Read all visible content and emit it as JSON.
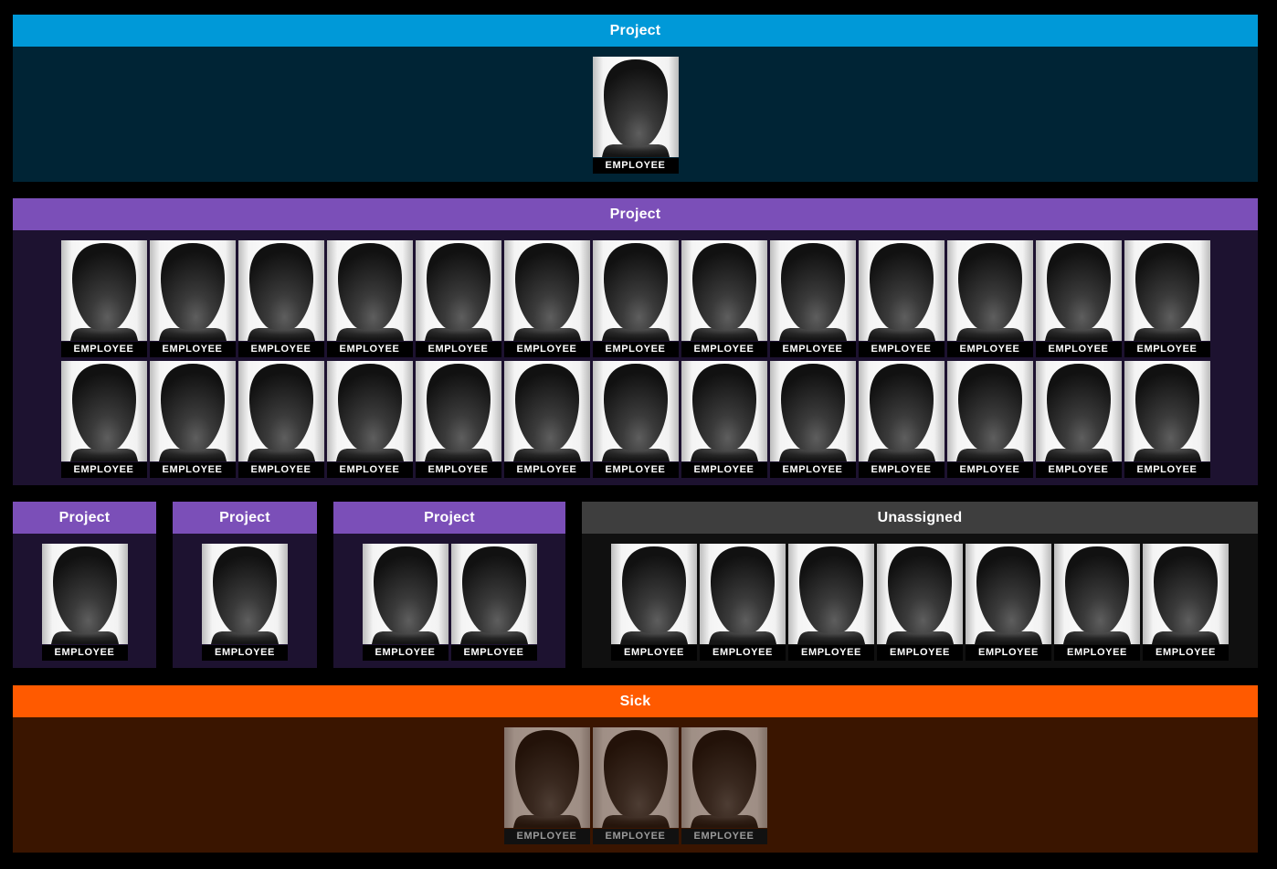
{
  "colors": {
    "page_bg": "#000000",
    "project_blue_header": "#0099D8",
    "project_blue_body": "#002435",
    "project_purple_header": "#7B4FB8",
    "project_purple_body": "#1D1230",
    "unassigned_header": "#3E3E3E",
    "unassigned_body": "#101010",
    "sick_header": "#FF5A00",
    "sick_body": "#3A1500"
  },
  "groups": [
    {
      "id": "g1",
      "title": "Project",
      "theme": "blue",
      "employees": [
        "EMPLOYEE"
      ]
    },
    {
      "id": "g2",
      "title": "Project",
      "theme": "purple",
      "employees": [
        "EMPLOYEE",
        "EMPLOYEE",
        "EMPLOYEE",
        "EMPLOYEE",
        "EMPLOYEE",
        "EMPLOYEE",
        "EMPLOYEE",
        "EMPLOYEE",
        "EMPLOYEE",
        "EMPLOYEE",
        "EMPLOYEE",
        "EMPLOYEE",
        "EMPLOYEE",
        "EMPLOYEE",
        "EMPLOYEE",
        "EMPLOYEE",
        "EMPLOYEE",
        "EMPLOYEE",
        "EMPLOYEE",
        "EMPLOYEE",
        "EMPLOYEE",
        "EMPLOYEE",
        "EMPLOYEE",
        "EMPLOYEE",
        "EMPLOYEE",
        "EMPLOYEE"
      ]
    },
    {
      "id": "g3",
      "title": "Project",
      "theme": "purple",
      "employees": [
        "EMPLOYEE"
      ]
    },
    {
      "id": "g4",
      "title": "Project",
      "theme": "purple",
      "employees": [
        "EMPLOYEE"
      ]
    },
    {
      "id": "g5",
      "title": "Project",
      "theme": "purple",
      "employees": [
        "EMPLOYEE",
        "EMPLOYEE"
      ]
    },
    {
      "id": "g6",
      "title": "Unassigned",
      "theme": "gray",
      "employees": [
        "EMPLOYEE",
        "EMPLOYEE",
        "EMPLOYEE",
        "EMPLOYEE",
        "EMPLOYEE",
        "EMPLOYEE",
        "EMPLOYEE"
      ]
    },
    {
      "id": "g7",
      "title": "Sick",
      "theme": "orange",
      "employees": [
        "EMPLOYEE",
        "EMPLOYEE",
        "EMPLOYEE"
      ]
    }
  ],
  "icons": {
    "employee_photo": "person-silhouette-icon"
  }
}
